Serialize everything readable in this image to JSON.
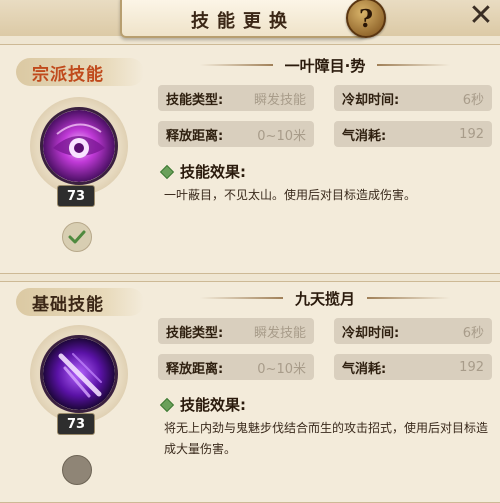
{
  "header": {
    "title": "技能更换",
    "help_glyph": "?",
    "close_glyph": "✕"
  },
  "panels": [
    {
      "category": "宗派技能",
      "level": "73",
      "selected": true,
      "skill_name": "一叶障目·势",
      "stats": {
        "type_label": "技能类型:",
        "type_value": "瞬发技能",
        "cooldown_label": "冷却时间:",
        "cooldown_value": "6秒",
        "range_label": "释放距离:",
        "range_value": "0~10米",
        "cost_label": "气消耗:",
        "cost_value": "192"
      },
      "effect_label": "技能效果:",
      "effect_text": "一叶蔽目，不见太山。使用后对目标造成伤害。"
    },
    {
      "category": "基础技能",
      "level": "73",
      "selected": false,
      "skill_name": "九天揽月",
      "stats": {
        "type_label": "技能类型:",
        "type_value": "瞬发技能",
        "cooldown_label": "冷却时间:",
        "cooldown_value": "6秒",
        "range_label": "释放距离:",
        "range_value": "0~10米",
        "cost_label": "气消耗:",
        "cost_value": "192"
      },
      "effect_label": "技能效果:",
      "effect_text": "将无上内劲与鬼魅步伐结合而生的攻击招式，使用后对目标造成大量伤害。"
    }
  ],
  "colors": {
    "sect_label": "#c04a1c",
    "stat_value": "#a89c8a",
    "check": "#4f8a3f"
  }
}
